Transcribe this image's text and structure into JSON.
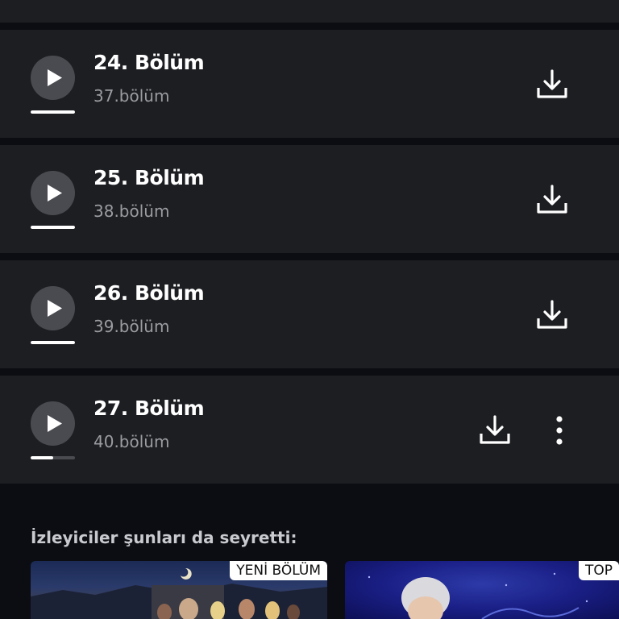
{
  "episodes": [
    {
      "title": "24. Bölüm",
      "subtitle": "37.bölüm",
      "progress": 1.0,
      "has_more_menu": false
    },
    {
      "title": "25. Bölüm",
      "subtitle": "38.bölüm",
      "progress": 1.0,
      "has_more_menu": false
    },
    {
      "title": "26. Bölüm",
      "subtitle": "39.bölüm",
      "progress": 1.0,
      "has_more_menu": false
    },
    {
      "title": "27. Bölüm",
      "subtitle": "40.bölüm",
      "progress": 0.5,
      "has_more_menu": true
    }
  ],
  "icons": {
    "play": "play-icon",
    "download": "download-icon",
    "more": "more-vertical-icon"
  },
  "recommendations": {
    "title": "İzleyiciler şunları da seyretti:",
    "items": [
      {
        "badge": "YENİ BÖLÜM"
      },
      {
        "badge": "TOP"
      }
    ]
  },
  "colors": {
    "background": "#0b0d12",
    "card": "#1d1e22",
    "play_circle": "#4a4b50",
    "subtitle_text": "#9b9ca1",
    "accent_white": "#ffffff"
  }
}
